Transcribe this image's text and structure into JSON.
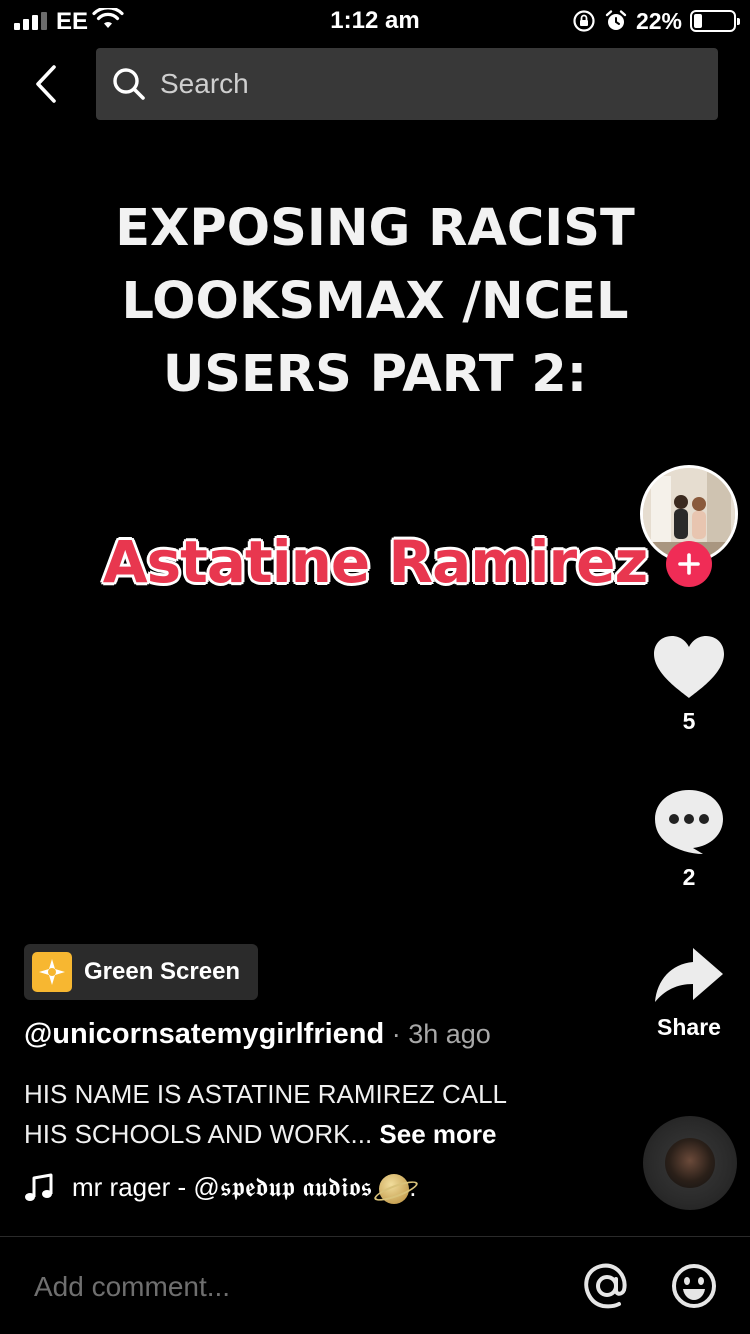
{
  "status_bar": {
    "carrier": "EE",
    "time": "1:12 am",
    "battery_percent": "22%",
    "battery_level": 0.22,
    "icons": [
      "signal-icon",
      "wifi-icon",
      "orientation-lock-icon",
      "alarm-icon",
      "battery-icon"
    ]
  },
  "header": {
    "back_icon": "chevron-left-icon",
    "search_placeholder": "Search"
  },
  "video": {
    "headline": "EXPOSING RACIST LOOKSMAX /NCEL USERS PART 2:",
    "name_sticker": "Astatine Ramirez",
    "sticker_color": "#e8374f"
  },
  "rail": {
    "likes": "5",
    "comments": "2",
    "share_label": "Share",
    "follow_color": "#f02c56"
  },
  "info": {
    "effect_label": "Green Screen",
    "username": "@unicornsatemygirlfriend",
    "separator": " · ",
    "time_ago": "3h ago",
    "caption_line1": "HIS NAME IS ASTATINE RAMIREZ CALL",
    "caption_line2": "HIS SCHOOLS AND WORK...",
    "see_more": "See more",
    "music": "mr rager - @𝖘𝖕𝖊𝖉𝖚𝖕 𝖆𝖚𝖉𝖎𝖔𝖘",
    "music_suffix": "."
  },
  "comment_bar": {
    "placeholder": "Add comment..."
  }
}
